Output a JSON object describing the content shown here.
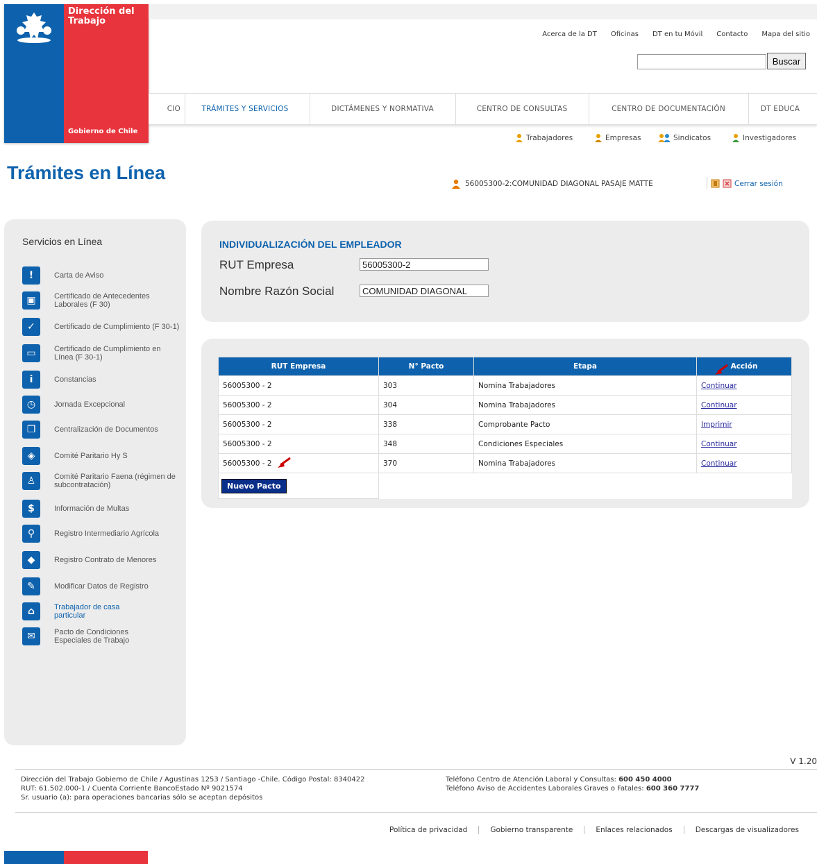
{
  "brand": {
    "title_line1": "Dirección del",
    "title_line2": "Trabajo",
    "government": "Gobierno de Chile",
    "blue": "#0e62ad",
    "red": "#e8343c"
  },
  "top_links": [
    "Acerca de la DT",
    "Oficinas",
    "DT en tu Móvil",
    "Contacto",
    "Mapa del sitio"
  ],
  "search": {
    "placeholder": "",
    "button": "Buscar"
  },
  "main_nav": [
    {
      "label": "CIO",
      "active": false
    },
    {
      "label": "TRÁMITES Y SERVICIOS",
      "active": true
    },
    {
      "label": "DICTÁMENES Y NORMATIVA",
      "active": false
    },
    {
      "label": "CENTRO DE CONSULTAS",
      "active": false
    },
    {
      "label": "CENTRO DE DOCUMENTACIÓN",
      "active": false
    },
    {
      "label": "DT EDUCA",
      "active": false
    }
  ],
  "audience": [
    "Trabajadores",
    "Empresas",
    "Sindicatos",
    "Investigadores"
  ],
  "page_title": "Trámites en Línea",
  "session": {
    "user": "56005300-2:COMUNIDAD DIAGONAL PASAJE MATTE",
    "logout": "Cerrar sesión"
  },
  "sidebar": {
    "title": "Servicios en Línea",
    "items": [
      {
        "icon": "warning-letter-icon",
        "glyph": "!",
        "label": "Carta de Aviso"
      },
      {
        "icon": "certificate-icon",
        "glyph": "▣",
        "label": "Certificado de Antecedentes Laborales (F 30)"
      },
      {
        "icon": "certificate-check-icon",
        "glyph": "✓",
        "label": "Certificado de Cumplimiento (F 30-1)"
      },
      {
        "icon": "online-certificate-icon",
        "glyph": "▭",
        "label": "Certificado de Cumplimiento en Línea (F 30-1)"
      },
      {
        "icon": "document-icon",
        "glyph": "i",
        "label": "Constancias"
      },
      {
        "icon": "clock-icon",
        "glyph": "◷",
        "label": "Jornada Excepcional"
      },
      {
        "icon": "documents-icon",
        "glyph": "❐",
        "label": "Centralización de Documentos"
      },
      {
        "icon": "committee-icon",
        "glyph": "◈",
        "label": "Comité Paritario Hy S"
      },
      {
        "icon": "worker-icon",
        "glyph": "♙",
        "label": "Comité Paritario Faena (régimen de subcontratación)"
      },
      {
        "icon": "fines-icon",
        "glyph": "$",
        "label": "Información de Multas"
      },
      {
        "icon": "agricultural-icon",
        "glyph": "⚲",
        "label": "Registro Intermediario Agrícola"
      },
      {
        "icon": "minors-icon",
        "glyph": "◆",
        "label": "Registro Contrato de Menores"
      },
      {
        "icon": "edit-icon",
        "glyph": "✎",
        "label": "Modificar Datos de Registro"
      },
      {
        "icon": "house-icon",
        "glyph": "⌂",
        "label": "Trabajador de casa particular"
      },
      {
        "icon": "pact-icon",
        "glyph": "✉",
        "label": "Pacto de Condiciones Especiales de Trabajo"
      }
    ]
  },
  "employer": {
    "title": "INDIVIDUALIZACIÓN DEL EMPLEADOR",
    "rut_label": "RUT Empresa",
    "rut_value": "56005300-2",
    "name_label": "Nombre Razón Social",
    "name_value": "COMUNIDAD DIAGONAL"
  },
  "pacts": {
    "headers": [
      "RUT Empresa",
      "N° Pacto",
      "Etapa",
      "Acción"
    ],
    "rows": [
      {
        "rut": "56005300 - 2",
        "num": "303",
        "stage": "Nomina Trabajadores",
        "action": "Continuar"
      },
      {
        "rut": "56005300 - 2",
        "num": "304",
        "stage": "Nomina Trabajadores",
        "action": "Continuar"
      },
      {
        "rut": "56005300 - 2",
        "num": "338",
        "stage": "Comprobante Pacto",
        "action": "Imprimir"
      },
      {
        "rut": "56005300 - 2",
        "num": "348",
        "stage": "Condiciones Especiales",
        "action": "Continuar"
      },
      {
        "rut": "56005300 - 2",
        "num": "370",
        "stage": "Nomina Trabajadores",
        "action": "Continuar"
      }
    ],
    "new_button": "Nuevo Pacto"
  },
  "footer": {
    "version": "V 1.20",
    "address_line1": "Dirección del Trabajo Gobierno de Chile / Agustinas 1253 / Santiago -Chile. Código Postal: 8340422",
    "address_line2": "RUT: 61.502.000-1 / Cuenta Corriente BancoEstado Nº 9021574",
    "address_line3": "Sr. usuario (a): para operaciones bancarias sólo se aceptan depósitos",
    "phone1_label": "Teléfono Centro de Atención Laboral y Consultas:",
    "phone1": "600 450 4000",
    "phone2_label": "Teléfono Aviso de Accidentes Laborales Graves o Fatales:",
    "phone2": "600 360 7777",
    "links": [
      "Política de privacidad",
      "Gobierno transparente",
      "Enlaces relacionados",
      "Descargas de visualizadores"
    ]
  }
}
